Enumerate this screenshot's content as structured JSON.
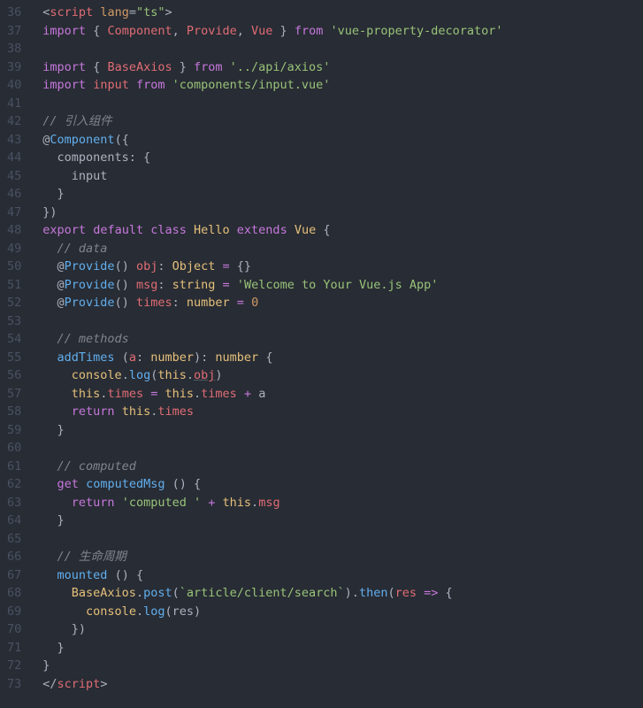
{
  "gutter": {
    "start": 36,
    "end": 73
  },
  "code": {
    "lines": [
      [
        {
          "cls": "c-punct",
          "t": "<"
        },
        {
          "cls": "c-tag",
          "t": "script"
        },
        {
          "cls": "c-default",
          "t": " "
        },
        {
          "cls": "c-attr",
          "t": "lang"
        },
        {
          "cls": "c-punct",
          "t": "="
        },
        {
          "cls": "c-string",
          "t": "\"ts\""
        },
        {
          "cls": "c-punct",
          "t": ">"
        }
      ],
      [
        {
          "cls": "c-keyword",
          "t": "import"
        },
        {
          "cls": "c-default",
          "t": " { "
        },
        {
          "cls": "c-var",
          "t": "Component"
        },
        {
          "cls": "c-default",
          "t": ", "
        },
        {
          "cls": "c-var",
          "t": "Provide"
        },
        {
          "cls": "c-default",
          "t": ", "
        },
        {
          "cls": "c-var",
          "t": "Vue"
        },
        {
          "cls": "c-default",
          "t": " } "
        },
        {
          "cls": "c-keyword",
          "t": "from"
        },
        {
          "cls": "c-default",
          "t": " "
        },
        {
          "cls": "c-string",
          "t": "'vue-property-decorator'"
        }
      ],
      [],
      [
        {
          "cls": "c-keyword",
          "t": "import"
        },
        {
          "cls": "c-default",
          "t": " { "
        },
        {
          "cls": "c-var",
          "t": "BaseAxios"
        },
        {
          "cls": "c-default",
          "t": " } "
        },
        {
          "cls": "c-keyword",
          "t": "from"
        },
        {
          "cls": "c-default",
          "t": " "
        },
        {
          "cls": "c-string",
          "t": "'../api/axios'"
        }
      ],
      [
        {
          "cls": "c-keyword",
          "t": "import"
        },
        {
          "cls": "c-default",
          "t": " "
        },
        {
          "cls": "c-var",
          "t": "input"
        },
        {
          "cls": "c-default",
          "t": " "
        },
        {
          "cls": "c-keyword",
          "t": "from"
        },
        {
          "cls": "c-default",
          "t": " "
        },
        {
          "cls": "c-string",
          "t": "'components/input.vue'"
        }
      ],
      [],
      [
        {
          "cls": "c-comment",
          "t": "// 引入组件"
        }
      ],
      [
        {
          "cls": "c-default",
          "t": "@"
        },
        {
          "cls": "c-func",
          "t": "Component"
        },
        {
          "cls": "c-default",
          "t": "({"
        }
      ],
      [
        {
          "cls": "c-default",
          "t": "  components: {"
        }
      ],
      [
        {
          "cls": "c-default",
          "t": "    input"
        }
      ],
      [
        {
          "cls": "c-default",
          "t": "  }"
        }
      ],
      [
        {
          "cls": "c-default",
          "t": "})"
        }
      ],
      [
        {
          "cls": "c-keyword",
          "t": "export"
        },
        {
          "cls": "c-default",
          "t": " "
        },
        {
          "cls": "c-keyword",
          "t": "default"
        },
        {
          "cls": "c-default",
          "t": " "
        },
        {
          "cls": "c-keyword",
          "t": "class"
        },
        {
          "cls": "c-default",
          "t": " "
        },
        {
          "cls": "c-class",
          "t": "Hello"
        },
        {
          "cls": "c-default",
          "t": " "
        },
        {
          "cls": "c-keyword",
          "t": "extends"
        },
        {
          "cls": "c-default",
          "t": " "
        },
        {
          "cls": "c-class",
          "t": "Vue"
        },
        {
          "cls": "c-default",
          "t": " {"
        }
      ],
      [
        {
          "cls": "c-default",
          "t": "  "
        },
        {
          "cls": "c-comment",
          "t": "// data"
        }
      ],
      [
        {
          "cls": "c-default",
          "t": "  @"
        },
        {
          "cls": "c-func",
          "t": "Provide"
        },
        {
          "cls": "c-default",
          "t": "() "
        },
        {
          "cls": "c-var",
          "t": "obj"
        },
        {
          "cls": "c-default",
          "t": ": "
        },
        {
          "cls": "c-class",
          "t": "Object"
        },
        {
          "cls": "c-default",
          "t": " "
        },
        {
          "cls": "c-keyword",
          "t": "="
        },
        {
          "cls": "c-default",
          "t": " {}"
        }
      ],
      [
        {
          "cls": "c-default",
          "t": "  @"
        },
        {
          "cls": "c-func",
          "t": "Provide"
        },
        {
          "cls": "c-default",
          "t": "() "
        },
        {
          "cls": "c-var",
          "t": "msg"
        },
        {
          "cls": "c-default",
          "t": ": "
        },
        {
          "cls": "c-class",
          "t": "string"
        },
        {
          "cls": "c-default",
          "t": " "
        },
        {
          "cls": "c-keyword",
          "t": "="
        },
        {
          "cls": "c-default",
          "t": " "
        },
        {
          "cls": "c-string",
          "t": "'Welcome to Your Vue.js App'"
        }
      ],
      [
        {
          "cls": "c-default",
          "t": "  @"
        },
        {
          "cls": "c-func",
          "t": "Provide"
        },
        {
          "cls": "c-default",
          "t": "() "
        },
        {
          "cls": "c-var",
          "t": "times"
        },
        {
          "cls": "c-default",
          "t": ": "
        },
        {
          "cls": "c-class",
          "t": "number"
        },
        {
          "cls": "c-default",
          "t": " "
        },
        {
          "cls": "c-keyword",
          "t": "="
        },
        {
          "cls": "c-default",
          "t": " "
        },
        {
          "cls": "c-number",
          "t": "0"
        }
      ],
      [],
      [
        {
          "cls": "c-default",
          "t": "  "
        },
        {
          "cls": "c-comment",
          "t": "// methods"
        }
      ],
      [
        {
          "cls": "c-default",
          "t": "  "
        },
        {
          "cls": "c-func",
          "t": "addTimes"
        },
        {
          "cls": "c-default",
          "t": " ("
        },
        {
          "cls": "c-var",
          "t": "a"
        },
        {
          "cls": "c-default",
          "t": ": "
        },
        {
          "cls": "c-class",
          "t": "number"
        },
        {
          "cls": "c-default",
          "t": "): "
        },
        {
          "cls": "c-class",
          "t": "number"
        },
        {
          "cls": "c-default",
          "t": " {"
        }
      ],
      [
        {
          "cls": "c-default",
          "t": "    "
        },
        {
          "cls": "c-class",
          "t": "console"
        },
        {
          "cls": "c-default",
          "t": "."
        },
        {
          "cls": "c-func",
          "t": "log"
        },
        {
          "cls": "c-default",
          "t": "("
        },
        {
          "cls": "c-this",
          "t": "this"
        },
        {
          "cls": "c-default",
          "t": "."
        },
        {
          "cls": "c-prop underline",
          "t": "obj"
        },
        {
          "cls": "c-default",
          "t": ")"
        }
      ],
      [
        {
          "cls": "c-default",
          "t": "    "
        },
        {
          "cls": "c-this",
          "t": "this"
        },
        {
          "cls": "c-default",
          "t": "."
        },
        {
          "cls": "c-prop",
          "t": "times"
        },
        {
          "cls": "c-default",
          "t": " "
        },
        {
          "cls": "c-keyword",
          "t": "="
        },
        {
          "cls": "c-default",
          "t": " "
        },
        {
          "cls": "c-this",
          "t": "this"
        },
        {
          "cls": "c-default",
          "t": "."
        },
        {
          "cls": "c-prop",
          "t": "times"
        },
        {
          "cls": "c-default",
          "t": " "
        },
        {
          "cls": "c-keyword",
          "t": "+"
        },
        {
          "cls": "c-default",
          "t": " a"
        }
      ],
      [
        {
          "cls": "c-default",
          "t": "    "
        },
        {
          "cls": "c-keyword",
          "t": "return"
        },
        {
          "cls": "c-default",
          "t": " "
        },
        {
          "cls": "c-this",
          "t": "this"
        },
        {
          "cls": "c-default",
          "t": "."
        },
        {
          "cls": "c-prop",
          "t": "times"
        }
      ],
      [
        {
          "cls": "c-default",
          "t": "  }"
        }
      ],
      [],
      [
        {
          "cls": "c-default",
          "t": "  "
        },
        {
          "cls": "c-comment",
          "t": "// computed"
        }
      ],
      [
        {
          "cls": "c-default",
          "t": "  "
        },
        {
          "cls": "c-keyword",
          "t": "get"
        },
        {
          "cls": "c-default",
          "t": " "
        },
        {
          "cls": "c-func",
          "t": "computedMsg"
        },
        {
          "cls": "c-default",
          "t": " () {"
        }
      ],
      [
        {
          "cls": "c-default",
          "t": "    "
        },
        {
          "cls": "c-keyword",
          "t": "return"
        },
        {
          "cls": "c-default",
          "t": " "
        },
        {
          "cls": "c-string",
          "t": "'computed '"
        },
        {
          "cls": "c-default",
          "t": " "
        },
        {
          "cls": "c-keyword",
          "t": "+"
        },
        {
          "cls": "c-default",
          "t": " "
        },
        {
          "cls": "c-this",
          "t": "this"
        },
        {
          "cls": "c-default",
          "t": "."
        },
        {
          "cls": "c-prop",
          "t": "msg"
        }
      ],
      [
        {
          "cls": "c-default",
          "t": "  }"
        }
      ],
      [],
      [
        {
          "cls": "c-default",
          "t": "  "
        },
        {
          "cls": "c-comment",
          "t": "// 生命周期"
        }
      ],
      [
        {
          "cls": "c-default",
          "t": "  "
        },
        {
          "cls": "c-func",
          "t": "mounted"
        },
        {
          "cls": "c-default",
          "t": " () {"
        }
      ],
      [
        {
          "cls": "c-default",
          "t": "    "
        },
        {
          "cls": "c-class",
          "t": "BaseAxios"
        },
        {
          "cls": "c-default",
          "t": "."
        },
        {
          "cls": "c-func",
          "t": "post"
        },
        {
          "cls": "c-default",
          "t": "("
        },
        {
          "cls": "c-string",
          "t": "`article/client/search`"
        },
        {
          "cls": "c-default",
          "t": ")."
        },
        {
          "cls": "c-func",
          "t": "then"
        },
        {
          "cls": "c-default",
          "t": "("
        },
        {
          "cls": "c-var",
          "t": "res"
        },
        {
          "cls": "c-default",
          "t": " "
        },
        {
          "cls": "c-keyword",
          "t": "=>"
        },
        {
          "cls": "c-default",
          "t": " {"
        }
      ],
      [
        {
          "cls": "c-default",
          "t": "      "
        },
        {
          "cls": "c-class",
          "t": "console"
        },
        {
          "cls": "c-default",
          "t": "."
        },
        {
          "cls": "c-func",
          "t": "log"
        },
        {
          "cls": "c-default",
          "t": "(res)"
        }
      ],
      [
        {
          "cls": "c-default",
          "t": "    })"
        }
      ],
      [
        {
          "cls": "c-default",
          "t": "  }"
        }
      ],
      [
        {
          "cls": "c-default",
          "t": "}"
        }
      ],
      [
        {
          "cls": "c-punct",
          "t": "</"
        },
        {
          "cls": "c-tag",
          "t": "script"
        },
        {
          "cls": "c-punct",
          "t": ">"
        }
      ]
    ]
  }
}
